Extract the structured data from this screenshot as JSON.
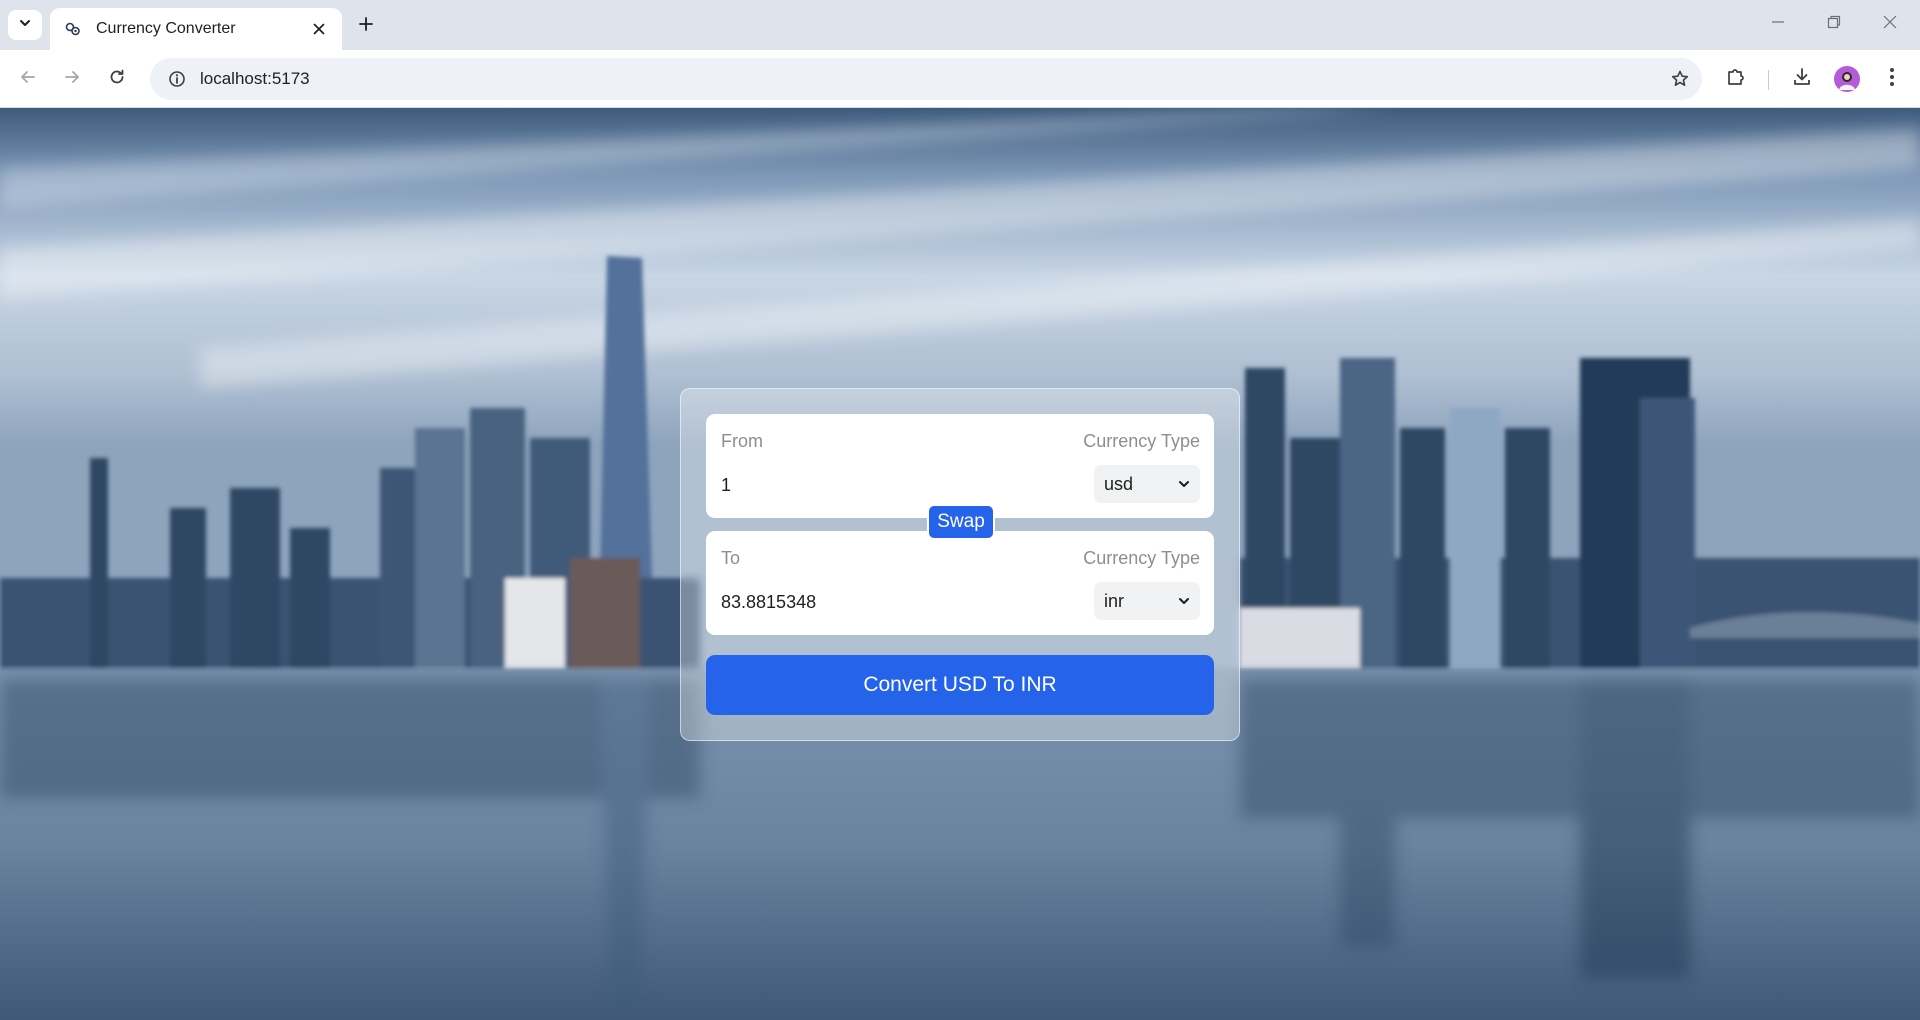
{
  "browser": {
    "tab_title": "Currency Converter",
    "url": "localhost:5173"
  },
  "converter": {
    "from": {
      "label": "From",
      "currency_type_label": "Currency Type",
      "amount": "1",
      "currency": "usd"
    },
    "swap_label": "Swap",
    "to": {
      "label": "To",
      "currency_type_label": "Currency Type",
      "amount": "83.8815348",
      "currency": "inr"
    },
    "convert_label": "Convert USD To INR"
  },
  "colors": {
    "accent": "#2563eb",
    "avatar": "#b65ad8"
  },
  "icons": [
    "tab-search-icon",
    "favicon-icon",
    "close-icon",
    "plus-icon",
    "minimize-icon",
    "restore-icon",
    "back-icon",
    "forward-icon",
    "reload-icon",
    "site-info-icon",
    "star-icon",
    "extensions-icon",
    "download-icon",
    "menu-icon",
    "chevron-down-icon"
  ]
}
